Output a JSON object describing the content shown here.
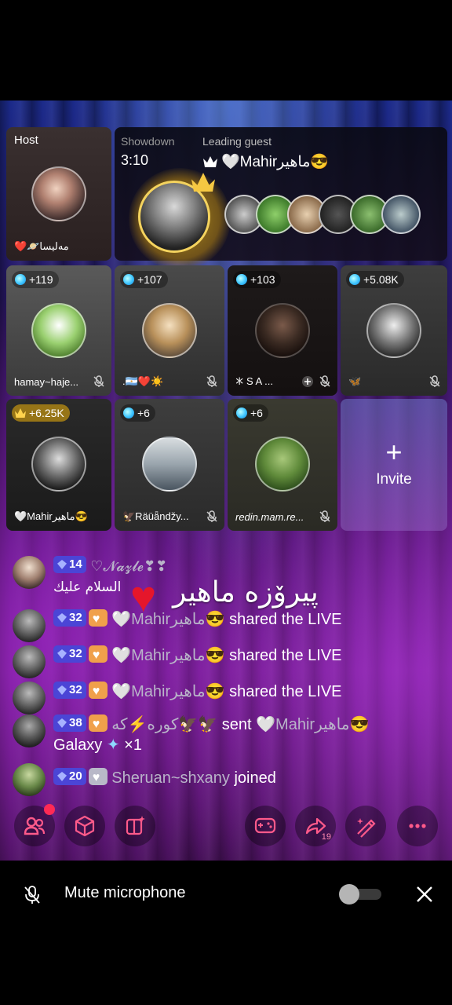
{
  "host": {
    "tag": "Host",
    "name": "❤️🪐مەلیسا"
  },
  "showdown": {
    "label": "Showdown",
    "timer": "3:10",
    "leading_label": "Leading guest",
    "leader_name": "🤍Mahirماهیر😎"
  },
  "guests": [
    {
      "score": "+119",
      "name": "hamay~haje..."
    },
    {
      "score": "+107",
      "name": ".🇦🇷❤️☀️"
    },
    {
      "score": "+103",
      "name": "𐠀 S A ..."
    },
    {
      "score": "+5.08K",
      "name": "🦋"
    },
    {
      "score": "+6.25K",
      "name": "🤍Mahirماهیر😎"
    },
    {
      "score": "+6",
      "name": "🦅Räüǟndžy..."
    },
    {
      "score": "+6",
      "name": "redin.mam.re..."
    }
  ],
  "invite": {
    "label": "Invite"
  },
  "overlay_text": "پیرۆزه ماهیر",
  "chat": [
    {
      "level": "14",
      "user": "♡𝓝𝓪𝔃𝓵𝓮❣❣",
      "text": "السلام عليك"
    },
    {
      "level": "32",
      "user": "🤍Mahirماهیر😎",
      "action": "shared the LIVE"
    },
    {
      "level": "32",
      "user": "🤍Mahirماهیر😎",
      "action": "shared the LIVE"
    },
    {
      "level": "32",
      "user": "🤍Mahirماهیر😎",
      "action": "shared the LIVE"
    },
    {
      "level": "38",
      "user": "کوره⚡که🦅🦅",
      "action": "sent",
      "target": "🤍Mahirماهیر😎",
      "gift": "Galaxy",
      "gift_count": "×1"
    },
    {
      "level": "20",
      "user": "Sheruan~shxany",
      "action": "joined"
    }
  ],
  "toolbar": {
    "share_count": "19"
  },
  "bottom": {
    "mute_label": "Mute microphone"
  },
  "colors": {
    "accent_level": "#4b45d6",
    "notification_dot": "#ff2a55",
    "crown_gold": "#f5c842"
  }
}
